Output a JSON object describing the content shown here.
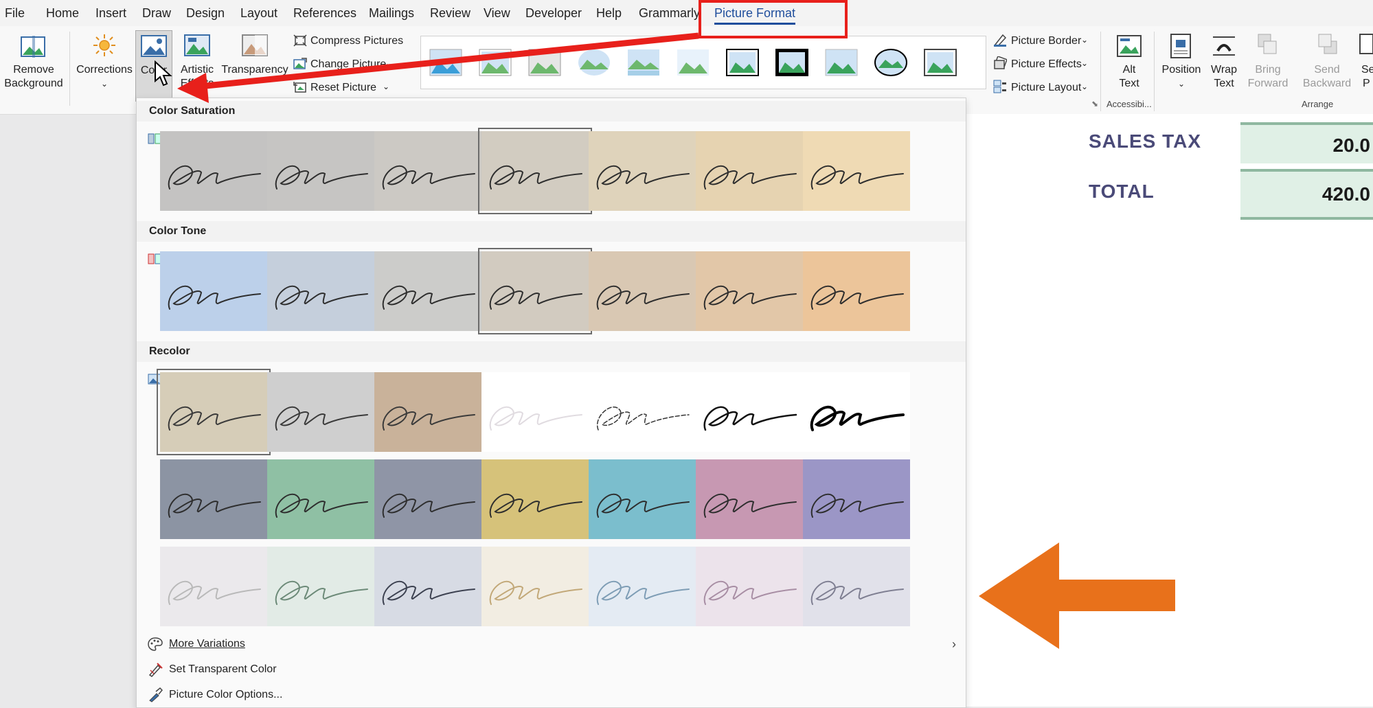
{
  "menu": {
    "tabs": [
      "File",
      "Home",
      "Insert",
      "Draw",
      "Design",
      "Layout",
      "References",
      "Mailings",
      "Review",
      "View",
      "Developer",
      "Help",
      "Grammarly",
      "Picture Format"
    ],
    "active_tab": "Picture Format"
  },
  "ribbon": {
    "remove_background": [
      "Remove",
      "Background"
    ],
    "corrections": "Corrections",
    "color": "Color",
    "artistic_effects": [
      "Artistic",
      "Effects"
    ],
    "transparency": "Transparency",
    "compress_pictures": "Compress Pictures",
    "change_picture": "Change Picture",
    "reset_picture": "Reset Picture",
    "picture_border": "Picture Border",
    "picture_effects": "Picture Effects",
    "picture_layout": "Picture Layout",
    "alt_text": [
      "Alt",
      "Text"
    ],
    "accessibility_group": "Accessibi...",
    "position": "Position",
    "wrap_text": [
      "Wrap",
      "Text"
    ],
    "bring_forward": [
      "Bring",
      "Forward"
    ],
    "send_backward": [
      "Send",
      "Backward"
    ],
    "selection_pane": [
      "Se",
      "P"
    ],
    "arrange_group": "Arrange"
  },
  "document": {
    "sales_tax_label": "SALES TAX",
    "sales_tax_value": "20.0",
    "total_label": "TOTAL",
    "total_value": "420.0"
  },
  "panel": {
    "color_saturation": "Color Saturation",
    "color_tone": "Color Tone",
    "recolor": "Recolor",
    "saturation_swatches": [
      "#c4c3c2",
      "#c6c5c3",
      "#ccc9c4",
      "#d2ccc1",
      "#dfd3bb",
      "#e6d3b1",
      "#efdab4"
    ],
    "tone_swatches": [
      "#bcd0ea",
      "#c5cfdc",
      "#ccccca",
      "#d2cbc0",
      "#d9c8b3",
      "#e2c7a8",
      "#ecc59a"
    ],
    "recolor_row1": [
      "#d6cdb8",
      "#cfcfcf",
      "#c9b29a",
      "#ffffff",
      "#ffffff",
      "#ffffff",
      "#ffffff"
    ],
    "recolor_row2": [
      "#8c94a3",
      "#8fc0a4",
      "#8f95a6",
      "#d6c27a",
      "#7bbecd",
      "#c798b2",
      "#9b96c6"
    ],
    "recolor_row3": [
      "#ebe9ec",
      "#e2ebe6",
      "#d7dbe4",
      "#f2ede2",
      "#e4ebf3",
      "#ece3eb",
      "#e1e1ea"
    ],
    "more_variations": "More Variations",
    "set_transparent_color": "Set Transparent Color",
    "picture_color_options": "Picture Color Options..."
  },
  "annotations": {
    "highlight_color": "#e8201b",
    "arrow_color": "#e8711b"
  }
}
